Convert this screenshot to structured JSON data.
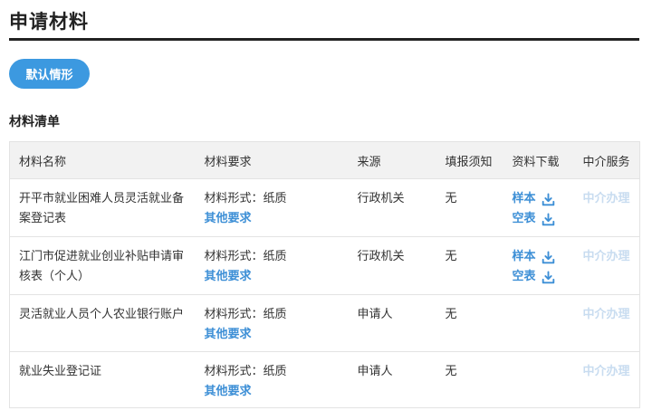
{
  "page": {
    "title": "申请材料",
    "scenario_button": "默认情形",
    "section_title": "材料清单"
  },
  "table": {
    "headers": [
      "材料名称",
      "材料要求",
      "来源",
      "填报须知",
      "资料下载",
      "中介服务"
    ],
    "rows": [
      {
        "name": "开平市就业困难人员灵活就业备案登记表",
        "form": "材料形式：纸质",
        "other": "其他要求",
        "source": "行政机关",
        "notice": "无",
        "sample": "样本",
        "blank": "空表",
        "agency": "中介办理"
      },
      {
        "name": "江门市促进就业创业补贴申请审核表（个人）",
        "form": "材料形式：纸质",
        "other": "其他要求",
        "source": "行政机关",
        "notice": "无",
        "sample": "样本",
        "blank": "空表",
        "agency": "中介办理"
      },
      {
        "name": "灵活就业人员个人农业银行账户",
        "form": "材料形式：纸质",
        "other": "其他要求",
        "source": "申请人",
        "notice": "无",
        "agency": "中介办理"
      },
      {
        "name": "就业失业登记证",
        "form": "材料形式：纸质",
        "other": "其他要求",
        "source": "申请人",
        "notice": "无",
        "agency": "中介办理"
      }
    ]
  },
  "icons": {
    "download": "download-icon"
  },
  "colors": {
    "accent": "#3c99e0",
    "link": "#3d8fd6",
    "disabled": "#c8dcf0"
  }
}
